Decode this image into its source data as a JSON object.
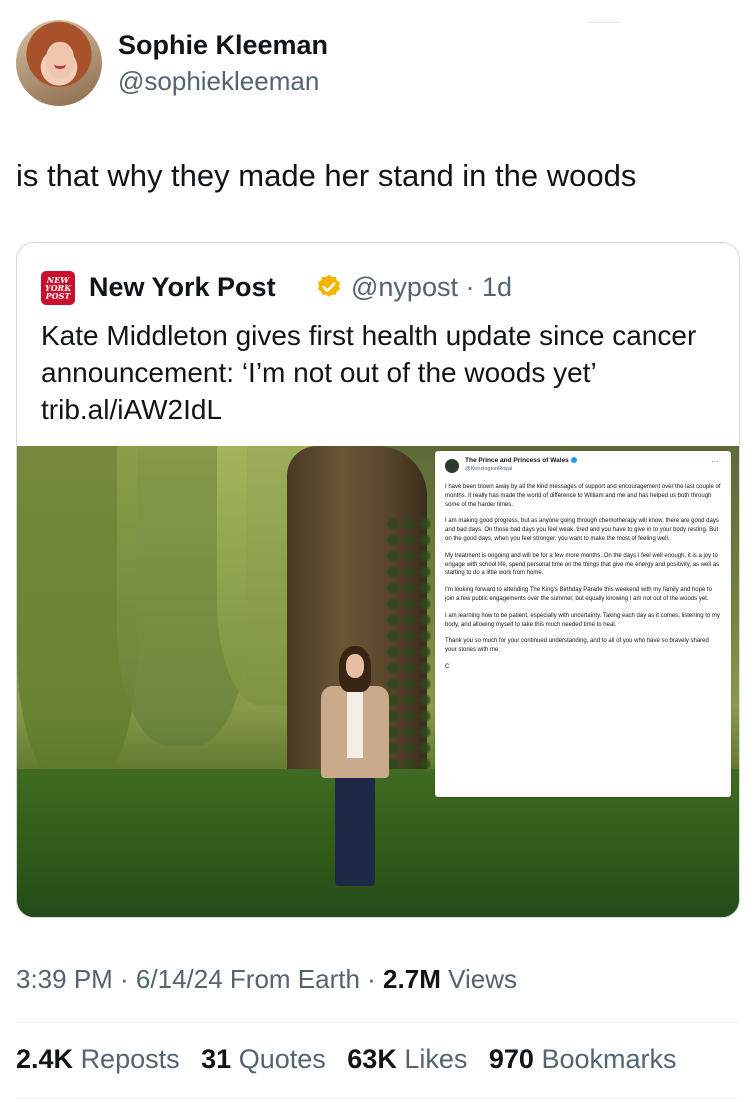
{
  "author": {
    "display_name": "Sophie Kleeman",
    "handle": "@sophiekleeman"
  },
  "tweet": {
    "text": "is that why they made her stand in the woods"
  },
  "quoted": {
    "logo_lines": [
      "NEW",
      "YORK",
      "POST"
    ],
    "name": "New York Post",
    "handle_time": "@nypost · 1d",
    "text": "Kate Middleton gives first health update since cancer announcement: ‘I’m not out of the woods yet’ trib.al/iAW2IdL",
    "image_post": {
      "name": "The Prince and Princess of Wales",
      "handle": "@KensingtonRoyal",
      "more": "···",
      "paragraphs": [
        "I have been blown away by all the kind messages of support and encouragement over the last couple of months. It really has made the world of difference to William and me and has helped us both through some of the harder times.",
        "I am making good progress, but as anyone going through chemotherapy will know, there are good days and bad days. On those bad days you feel weak, tired and you have to give in to your body resting. But on the good days, when you feel stronger, you want to make the most of feeling well.",
        "My treatment is ongoing and will be for a few more months. On the days I feel well enough, it is a joy to engage with school life, spend personal time on the things that give me energy and positivity, as well as starting to do a little work from home.",
        "I'm looking forward to attending The King's Birthday Parade this weekend with my family and hope to join a few public engagements over the summer, but equally knowing I am not out of the woods yet.",
        "I am learning how to be patient, especially with uncertainty. Taking each day as it comes, listening to my body, and allowing myself to take this much needed time to heal.",
        "Thank you so much for your continued understanding, and to all of you who have so bravely shared your stories with me.",
        "C"
      ]
    }
  },
  "meta": {
    "time_date": "3:39 PM · 6/14/24 From Earth · ",
    "views_count": "2.7M",
    "views_label": " Views"
  },
  "stats": {
    "reposts_count": "2.4K",
    "reposts_label": "Reposts",
    "quotes_count": "31",
    "quotes_label": "Quotes",
    "likes_count": "63K",
    "likes_label": "Likes",
    "bookmarks_count": "970",
    "bookmarks_label": "Bookmarks"
  },
  "colors": {
    "text": "#0f1419",
    "secondary": "#536471",
    "border": "#cfd9de",
    "nypost_red": "#c8102e",
    "verified_gold": "#f4b400"
  }
}
